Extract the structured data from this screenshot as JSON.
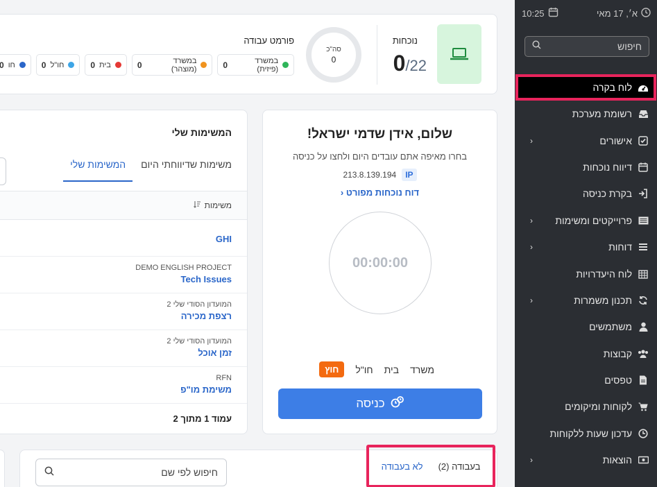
{
  "sidebar": {
    "date": "א׳, 17 מאי",
    "time": "10:25",
    "search_placeholder": "חיפוש",
    "items": [
      {
        "label": "לוח בקרה",
        "icon": "dashboard-icon",
        "chevron": false
      },
      {
        "label": "רשומת מערכת",
        "icon": "inbox-icon",
        "chevron": false
      },
      {
        "label": "אישורים",
        "icon": "checkbox-icon",
        "chevron": true
      },
      {
        "label": "דיווח נוכחות",
        "icon": "calendar-icon",
        "chevron": false
      },
      {
        "label": "בקרת כניסה",
        "icon": "sign-in-icon",
        "chevron": false
      },
      {
        "label": "פרוייקטים ומשימות",
        "icon": "projects-icon",
        "chevron": true
      },
      {
        "label": "דוחות",
        "icon": "list-icon",
        "chevron": true
      },
      {
        "label": "לוח היעדרויות",
        "icon": "calendar-grid-icon",
        "chevron": false
      },
      {
        "label": "תכנון משמרות",
        "icon": "refresh-icon",
        "chevron": true
      },
      {
        "label": "משתמשים",
        "icon": "user-icon",
        "chevron": false
      },
      {
        "label": "קבוצות",
        "icon": "users-icon",
        "chevron": false
      },
      {
        "label": "טפסים",
        "icon": "file-icon",
        "chevron": false
      },
      {
        "label": "לקוחות ומיקומים",
        "icon": "cart-icon",
        "chevron": false
      },
      {
        "label": "עדכון שעות ללקוחות",
        "icon": "clock-icon",
        "chevron": false
      },
      {
        "label": "הוצאות",
        "icon": "money-icon",
        "chevron": true
      }
    ]
  },
  "stats": {
    "attendance_label": "נוכחות",
    "attendance_value": "0",
    "attendance_total": "/22",
    "total_label": "סה\"כ",
    "total_value": "0",
    "format_label": "פורמט עבודה",
    "chips": [
      {
        "label": "במשרד (פיזית)",
        "value": "0",
        "color": "#2fb55a"
      },
      {
        "label": "במשרד (מוצהר)",
        "value": "0",
        "color": "#f0931e"
      },
      {
        "label": "בית",
        "value": "0",
        "color": "#e53935"
      },
      {
        "label": "חו\"ל",
        "value": "0",
        "color": "#3da5e6"
      },
      {
        "label": "חו",
        "value": "0",
        "color": "#2a66c9"
      }
    ]
  },
  "welcome": {
    "title": "שלום, אידן שדמי ישראל!",
    "subtitle": "בחרו מאיפה אתם עובדים היום ולחצו על כניסה",
    "ip_tag": "IP",
    "ip": "213.8.139.194",
    "report_link": "דוח נוכחות מפורט",
    "timer": "00:00:00",
    "locations": [
      "משרד",
      "בית",
      "חו\"ל",
      "חוץ"
    ],
    "active_location": "חוץ",
    "enter_label": "כניסה"
  },
  "tasks": {
    "title": "המשימות שלי",
    "tabs": [
      "משימות שדיווחתי היום",
      "המשימות שלי"
    ],
    "column": "משימות",
    "rows": [
      {
        "project": "",
        "task": "GHI"
      },
      {
        "project": "DEMO ENGLISH PROJECT",
        "task": "Tech Issues"
      },
      {
        "project": "המועדון הסודי שלי 2",
        "task": "רצפת מכירה"
      },
      {
        "project": "המועדון הסודי שלי 2",
        "task": "זמן אוכל"
      },
      {
        "project": "RFN",
        "task": "משימת מו\"פ"
      }
    ],
    "footer": "עמוד 1 מתוך 2"
  },
  "bottom": {
    "working": "בעבודה (2)",
    "not_working": "לא בעבודה",
    "search_placeholder": "חיפוש לפי שם"
  },
  "colors": {
    "sidebar_bg": "#2b2e33",
    "accent": "#3d7ee6",
    "highlight": "#e8245c",
    "active_location": "#f36a10"
  }
}
